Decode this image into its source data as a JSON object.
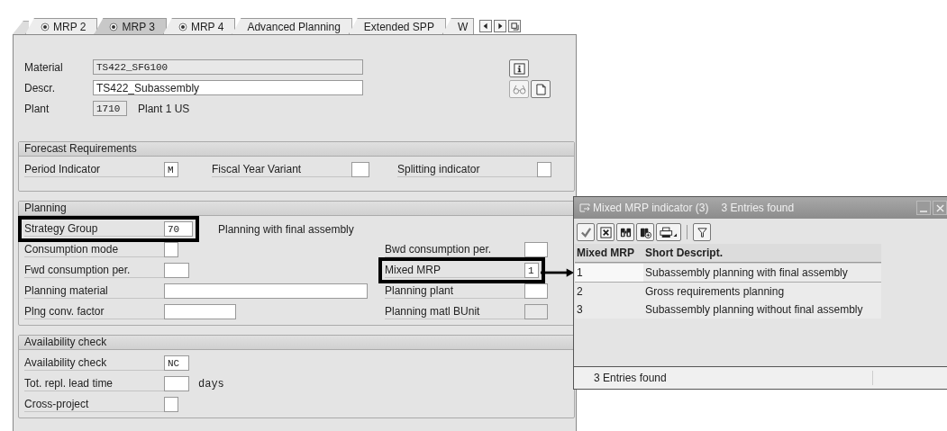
{
  "tabs": [
    {
      "label": "MRP 2",
      "selected": false,
      "kind": "radio"
    },
    {
      "label": "MRP 3",
      "selected": true,
      "kind": "radio"
    },
    {
      "label": "MRP 4",
      "selected": false,
      "kind": "radio"
    },
    {
      "label": "Advanced Planning",
      "selected": false,
      "kind": "plain"
    },
    {
      "label": "Extended SPP",
      "selected": false,
      "kind": "plain"
    },
    {
      "label": "W",
      "selected": false,
      "kind": "plain"
    }
  ],
  "header": {
    "fields": [
      {
        "label": "Material",
        "value": "TS422_SFG100",
        "disabled": true,
        "kind": "code"
      },
      {
        "label": "Descr.",
        "value": "TS422_Subassembly",
        "disabled": false,
        "kind": "text"
      },
      {
        "label": "Plant",
        "value": "1710",
        "disabled": true,
        "kind": "code",
        "note": "Plant 1 US"
      }
    ]
  },
  "groups": [
    {
      "title": "Forecast Requirements",
      "rows": [
        {
          "cells": [
            {
              "label": "Period Indicator",
              "value": "M",
              "highlighted": false
            },
            {
              "label": "Fiscal Year Variant",
              "highlighted": false
            },
            {
              "label": "Splitting indicator",
              "highlighted": false
            }
          ]
        }
      ]
    },
    {
      "title": "Planning",
      "rows": [
        {
          "cells": [
            {
              "label": "Strategy Group",
              "value": "70",
              "highlighted": true,
              "note": "Planning with final assembly"
            }
          ]
        },
        {
          "cells": [
            {
              "label": "Consumption mode",
              "highlighted": false
            },
            {
              "label": "Bwd consumption per.",
              "highlighted": false
            }
          ]
        },
        {
          "cells": [
            {
              "label": "Fwd consumption per.",
              "highlighted": false
            },
            {
              "label": "Mixed MRP",
              "value": "1",
              "highlighted": true
            }
          ]
        },
        {
          "cells": [
            {
              "label": "Planning material",
              "highlighted": false
            },
            {
              "label": "Planning plant",
              "highlighted": false
            }
          ]
        },
        {
          "cells": [
            {
              "label": "Plng conv. factor",
              "highlighted": false
            },
            {
              "label": "Planning matl BUnit",
              "disabled": true,
              "highlighted": false
            }
          ]
        }
      ]
    },
    {
      "title": "Availability check",
      "rows": [
        {
          "cells": [
            {
              "label": "Availability check",
              "value": "NC",
              "highlighted": false
            }
          ]
        },
        {
          "cells": [
            {
              "label": "Tot. repl. lead time",
              "highlighted": false,
              "unit": "days"
            }
          ]
        },
        {
          "cells": [
            {
              "label": "Cross-project",
              "highlighted": false
            }
          ]
        }
      ]
    }
  ],
  "popup": {
    "title": "Mixed MRP indicator (3)",
    "subtitle": "3 Entries found",
    "pointer": true,
    "columns": [
      "Mixed MRP",
      "Short Descript."
    ],
    "rows": [
      {
        "cells": [
          "1",
          "Subassembly planning with final assembly"
        ],
        "selected": true
      },
      {
        "cells": [
          "2",
          "Gross requirements planning"
        ],
        "selected": false
      },
      {
        "cells": [
          "3",
          "Subassembly planning without final assembly"
        ],
        "selected": false
      }
    ],
    "status": "3 Entries found"
  }
}
